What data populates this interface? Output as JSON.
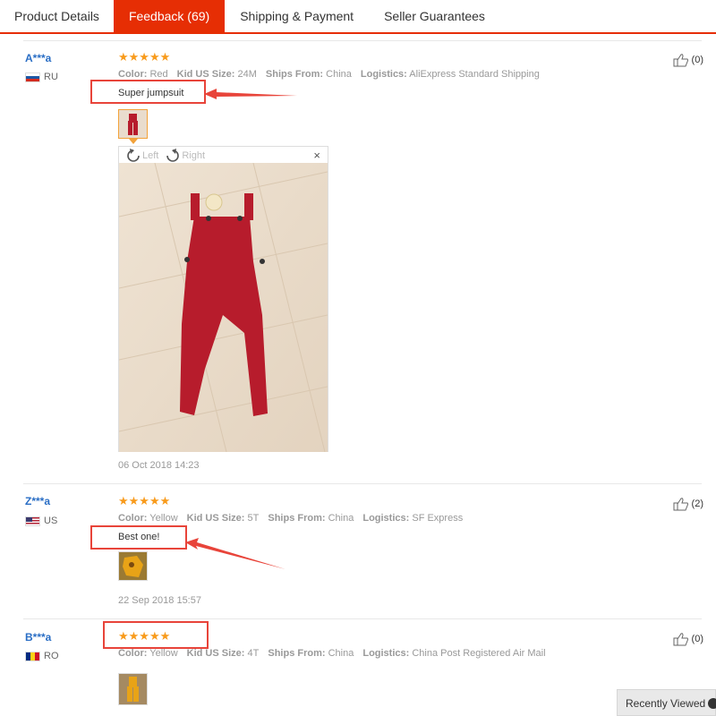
{
  "tabs": [
    {
      "label": "Product Details"
    },
    {
      "label": "Feedback (69)"
    },
    {
      "label": "Shipping & Payment"
    },
    {
      "label": "Seller Guarantees"
    }
  ],
  "feedbacks": [
    {
      "user": "A***a",
      "country": "RU",
      "stars": "★★★★★",
      "color_label": "Color:",
      "color": "Red",
      "size_label": "Kid US Size:",
      "size": "24M",
      "ships_label": "Ships From:",
      "ships": "China",
      "logistics_label": "Logistics:",
      "logistics": "AliExpress Standard Shipping",
      "comment": "Super jumpsuit",
      "date": "06 Oct 2018 14:23",
      "helpful": "(0)"
    },
    {
      "user": "Z***a",
      "country": "US",
      "stars": "★★★★★",
      "color_label": "Color:",
      "color": "Yellow",
      "size_label": "Kid US Size:",
      "size": "5T",
      "ships_label": "Ships From:",
      "ships": "China",
      "logistics_label": "Logistics:",
      "logistics": "SF Express",
      "comment": "Best one!",
      "date": "22 Sep 2018 15:57",
      "helpful": "(2)"
    },
    {
      "user": "B***a",
      "country": "RO",
      "stars": "★★★★★",
      "color_label": "Color:",
      "color": "Yellow",
      "size_label": "Kid US Size:",
      "size": "4T",
      "ships_label": "Ships From:",
      "ships": "China",
      "logistics_label": "Logistics:",
      "logistics": "China Post Registered Air Mail",
      "helpful": "(0)"
    }
  ],
  "viewer": {
    "rotate_left": "Left",
    "rotate_right": "Right",
    "close": "×"
  },
  "recently_viewed": "Recently Viewed",
  "colors": {
    "accent": "#e62e04",
    "star": "#f89b1c",
    "username": "#2a6ec5",
    "annotation": "#e8443a",
    "garment_red": "#b71c2c",
    "garment_yellow": "#e8a317"
  }
}
